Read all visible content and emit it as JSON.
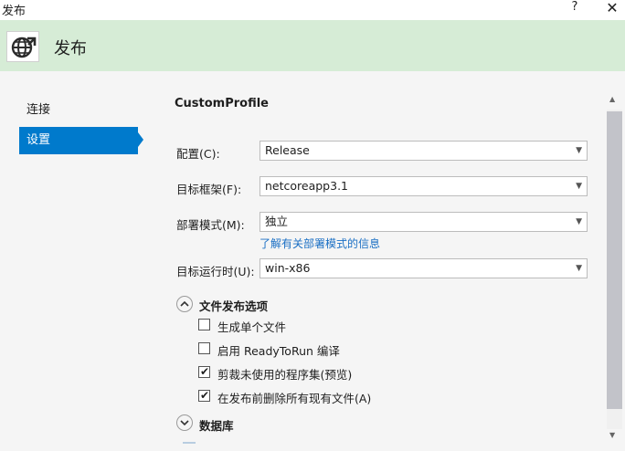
{
  "window": {
    "title": "发布",
    "help": "?",
    "close": "✕"
  },
  "header": {
    "title": "发布",
    "icon": "globe-publish-icon"
  },
  "nav": {
    "items": [
      {
        "label": "连接",
        "active": false
      },
      {
        "label": "设置",
        "active": true
      }
    ]
  },
  "profile": {
    "name": "CustomProfile"
  },
  "form": {
    "configuration": {
      "label": "配置(C):",
      "value": "Release"
    },
    "target_framework": {
      "label": "目标框架(F):",
      "value": "netcoreapp3.1"
    },
    "deployment_mode": {
      "label": "部署模式(M):",
      "value": "独立",
      "help_link": "了解有关部署模式的信息"
    },
    "target_runtime": {
      "label": "目标运行时(U):",
      "value": "win-x86"
    }
  },
  "file_publish_options": {
    "title": "文件发布选项",
    "expanded": true,
    "options": [
      {
        "label": "生成单个文件",
        "checked": false
      },
      {
        "label": "启用 ReadyToRun 编译",
        "checked": false
      },
      {
        "label": "剪裁未使用的程序集(预览)",
        "checked": true
      },
      {
        "label": "在发布前删除所有现有文件(A)",
        "checked": true
      }
    ]
  },
  "database": {
    "title": "数据库",
    "expanded": false
  },
  "colors": {
    "accent": "#007acc",
    "header_bg": "#d6ecd6",
    "link": "#1a6fc4"
  }
}
